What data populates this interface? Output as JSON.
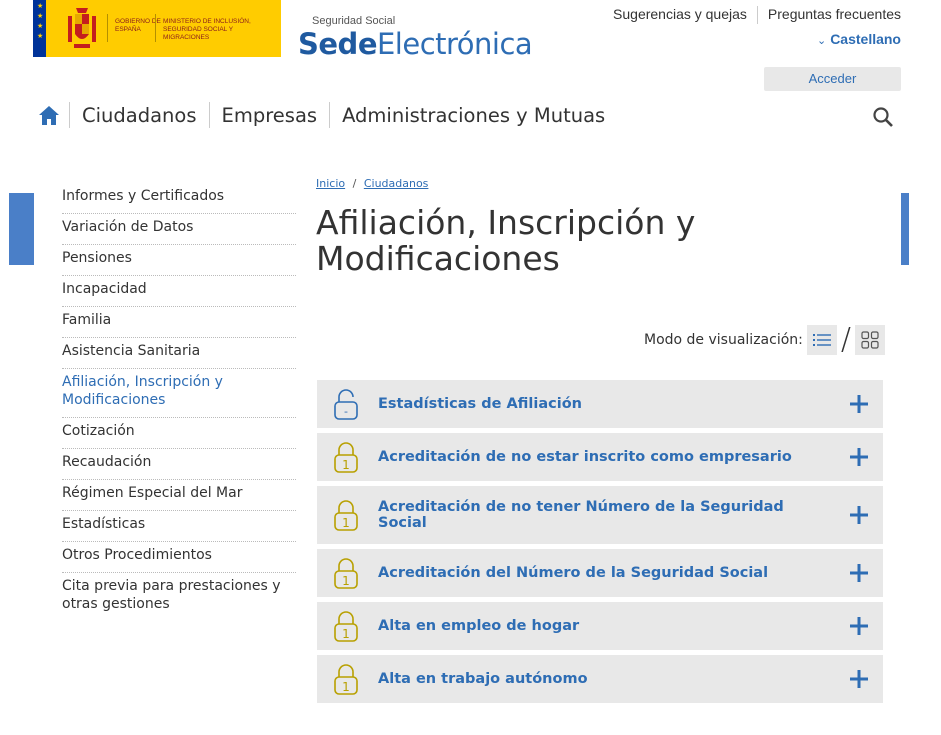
{
  "header": {
    "gov_line1": "GOBIERNO DE ESPAÑA",
    "gov_line2": "MINISTERIO DE INCLUSIÓN, SEGURIDAD SOCIAL Y MIGRACIONES",
    "brand_small": "Seguridad Social",
    "brand_bold": "Sede",
    "brand_light": "Electrónica",
    "top_links": [
      "Sugerencias y quejas",
      "Preguntas frecuentes"
    ],
    "language": "Castellano",
    "login_label": "Acceder",
    "nav": [
      "Ciudadanos",
      "Empresas",
      "Administraciones y Mutuas"
    ]
  },
  "sidebar": {
    "items": [
      {
        "label": "Informes y Certificados"
      },
      {
        "label": "Variación de Datos"
      },
      {
        "label": "Pensiones"
      },
      {
        "label": "Incapacidad"
      },
      {
        "label": "Familia"
      },
      {
        "label": "Asistencia Sanitaria"
      },
      {
        "label": "Afiliación, Inscripción y Modificaciones",
        "active": true
      },
      {
        "label": "Cotización"
      },
      {
        "label": "Recaudación"
      },
      {
        "label": "Régimen Especial del Mar"
      },
      {
        "label": "Estadísticas"
      },
      {
        "label": "Otros Procedimientos"
      },
      {
        "label": "Cita previa para prestaciones y otras gestiones"
      }
    ]
  },
  "breadcrumb": {
    "home": "Inicio",
    "sep": "/",
    "current": "Ciudadanos"
  },
  "page": {
    "title": "Afiliación, Inscripción y Modificaciones",
    "view_mode_label": "Modo de visualización:",
    "view_sep": "/"
  },
  "procedures": [
    {
      "title": "Estadísticas de Afiliación",
      "lock": "open",
      "lock_mark": "-"
    },
    {
      "title": "Acreditación de no estar inscrito como empresario",
      "lock": "closed",
      "lock_mark": "1"
    },
    {
      "title": "Acreditación de no tener Número de la Seguridad Social",
      "lock": "closed",
      "lock_mark": "1"
    },
    {
      "title": "Acreditación del Número de la Seguridad Social",
      "lock": "closed",
      "lock_mark": "1"
    },
    {
      "title": "Alta en empleo de hogar",
      "lock": "closed",
      "lock_mark": "1"
    },
    {
      "title": "Alta en trabajo autónomo",
      "lock": "closed",
      "lock_mark": "1"
    }
  ],
  "colors": {
    "accent": "#2e6db4",
    "gov_yellow": "#ffcc00",
    "row_bg": "#e8e8e8",
    "lock_closed": "#b8a000",
    "lock_open": "#2e6db4"
  }
}
